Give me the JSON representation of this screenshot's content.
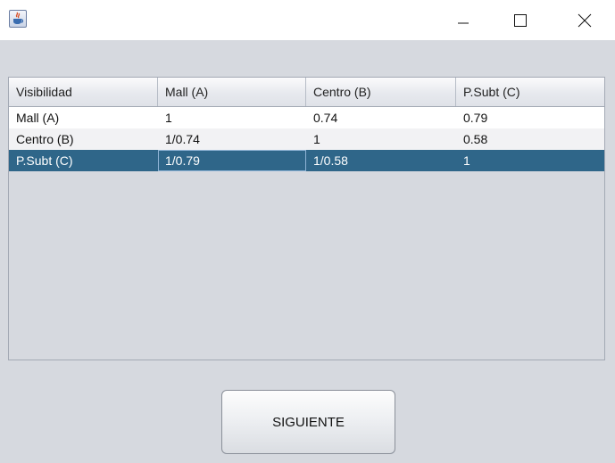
{
  "window": {
    "icon": "java-coffee-cup-icon",
    "controls": [
      "minimize-icon",
      "maximize-icon",
      "close-icon"
    ]
  },
  "table": {
    "columns": [
      "Visibilidad",
      "Mall (A)",
      "Centro (B)",
      "P.Subt (C)"
    ],
    "rows": [
      [
        "Mall (A)",
        "1",
        "0.74",
        "0.79"
      ],
      [
        "Centro (B)",
        "1/0.74",
        "1",
        "0.58"
      ],
      [
        "P.Subt (C)",
        "1/0.79",
        "1/0.58",
        "1"
      ]
    ],
    "selected_row": 2,
    "colors": {
      "selection": "#2f6689",
      "background": "#d6d9df"
    }
  },
  "buttons": {
    "next_label": "SIGUIENTE"
  }
}
